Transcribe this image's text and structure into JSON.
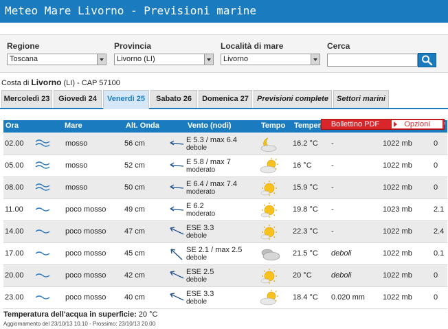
{
  "header": {
    "title": "Meteo Mare Livorno - Previsioni marine"
  },
  "filters": {
    "regione": {
      "label": "Regione",
      "value": "Toscana"
    },
    "provincia": {
      "label": "Provincia",
      "value": "Livorno (LI)"
    },
    "localita": {
      "label": "Località di mare",
      "value": "Livorno"
    },
    "cerca": {
      "label": "Cerca",
      "value": ""
    }
  },
  "location": {
    "prefix": "Costa di ",
    "name": "Livorno",
    "suffix": " (LI) - CAP 57100"
  },
  "tabs": [
    {
      "label": "Mercoledì 23",
      "active": false
    },
    {
      "label": "Giovedì 24",
      "active": false
    },
    {
      "label": "Venerdì 25",
      "active": true
    },
    {
      "label": "Sabato 26",
      "active": false
    },
    {
      "label": "Domenica 27",
      "active": false
    },
    {
      "label": "Previsioni complete",
      "active": false
    },
    {
      "label": "Settori marini",
      "active": false
    }
  ],
  "table": {
    "headers": {
      "ora": "Ora",
      "mare": "Mare",
      "onda": "Alt. Onda",
      "vento": "Vento (nodi)",
      "tempo": "Tempo",
      "temp": "Temper",
      "last": "/"
    },
    "rows": [
      {
        "ora": "02.00",
        "mare": "mosso",
        "onda": "56 cm",
        "vento": "E 5.3 / max 6.4",
        "vento_sub": "debole",
        "temp": "16.2 °C",
        "prec": "-",
        "press": "1022 mb",
        "last": "0"
      },
      {
        "ora": "05.00",
        "mare": "mosso",
        "onda": "52 cm",
        "vento": "E 5.8 / max 7",
        "vento_sub": "moderato",
        "temp": "16 °C",
        "prec": "-",
        "press": "1022 mb",
        "last": "0"
      },
      {
        "ora": "08.00",
        "mare": "mosso",
        "onda": "50 cm",
        "vento": "E 6.4 / max 7.4",
        "vento_sub": "moderato",
        "temp": "15.9 °C",
        "prec": "-",
        "press": "1022 mb",
        "last": "0"
      },
      {
        "ora": "11.00",
        "mare": "poco mosso",
        "onda": "49 cm",
        "vento": "E 6.2",
        "vento_sub": "moderato",
        "temp": "19.8 °C",
        "prec": "-",
        "press": "1023 mb",
        "last": "2.1"
      },
      {
        "ora": "14.00",
        "mare": "poco mosso",
        "onda": "47 cm",
        "vento": "ESE 3.3",
        "vento_sub": "debole",
        "temp": "22.3 °C",
        "prec": "-",
        "press": "1022 mb",
        "last": "2.4"
      },
      {
        "ora": "17.00",
        "mare": "poco mosso",
        "onda": "45 cm",
        "vento": "SE 2.1 / max 2.5",
        "vento_sub": "debole",
        "temp": "21.5 °C",
        "prec": "deboli",
        "press": "1022 mb",
        "last": "0.1"
      },
      {
        "ora": "20.00",
        "mare": "poco mosso",
        "onda": "42 cm",
        "vento": "ESE 2.5",
        "vento_sub": "debole",
        "temp": "20 °C",
        "prec": "deboli",
        "press": "1022 mb",
        "last": "0"
      },
      {
        "ora": "23.00",
        "mare": "poco mosso",
        "onda": "40 cm",
        "vento": "ESE 3.3",
        "vento_sub": "debole",
        "temp": "18.4 °C",
        "prec": "0.020 mm",
        "press": "1022 mb",
        "last": "0"
      }
    ]
  },
  "popup": {
    "pdf": "Bollettino PDF",
    "opzioni": "Opzioni"
  },
  "footer": {
    "water_label": "Temperatura dell'acqua in superficie:",
    "water_value": " 20 °C",
    "updated": "Aggiornamento del 23/10/13 10.10 - Prossimo: 23/10/13 20.00"
  },
  "colors": {
    "accent": "#1a7bbf",
    "popup": "#d8262b"
  },
  "icons": {
    "sea_rough": "double-wave-icon",
    "sea_calm": "single-wave-icon",
    "wind": "wind-arrow-icon",
    "weather": "weather-icon"
  }
}
